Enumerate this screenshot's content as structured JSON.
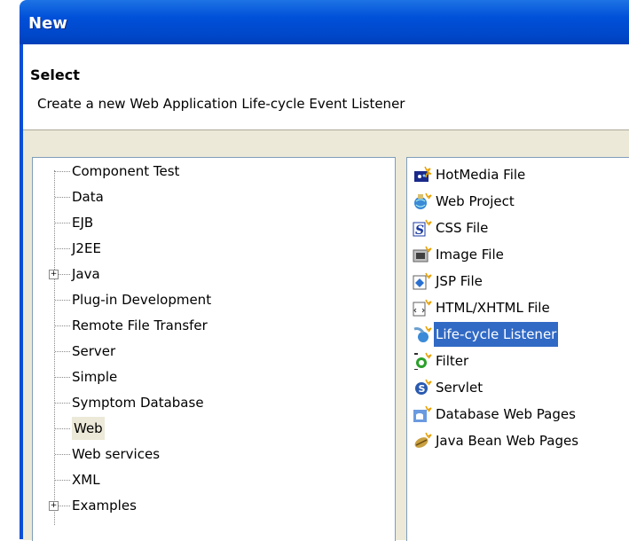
{
  "window": {
    "title": "New"
  },
  "header": {
    "title": "Select",
    "description": "Create a new Web Application Life-cycle Event Listener"
  },
  "tree": {
    "items": [
      {
        "label": "Component Test",
        "expandable": false
      },
      {
        "label": "Data",
        "expandable": false
      },
      {
        "label": "EJB",
        "expandable": false
      },
      {
        "label": "J2EE",
        "expandable": false
      },
      {
        "label": "Java",
        "expandable": true
      },
      {
        "label": "Plug-in Development",
        "expandable": false
      },
      {
        "label": "Remote File Transfer",
        "expandable": false
      },
      {
        "label": "Server",
        "expandable": false
      },
      {
        "label": "Simple",
        "expandable": false
      },
      {
        "label": "Symptom Database",
        "expandable": false
      },
      {
        "label": "Web",
        "expandable": false,
        "selected": true
      },
      {
        "label": "Web services",
        "expandable": false
      },
      {
        "label": "XML",
        "expandable": false
      },
      {
        "label": "Examples",
        "expandable": true
      }
    ],
    "expander_glyph": "+"
  },
  "wizards": {
    "items": [
      {
        "label": "HotMedia File",
        "icon": "hotmedia-file-icon"
      },
      {
        "label": "Web Project",
        "icon": "web-project-icon"
      },
      {
        "label": "CSS File",
        "icon": "css-file-icon"
      },
      {
        "label": "Image File",
        "icon": "image-file-icon"
      },
      {
        "label": "JSP File",
        "icon": "jsp-file-icon"
      },
      {
        "label": "HTML/XHTML File",
        "icon": "html-file-icon"
      },
      {
        "label": "Life-cycle Listener",
        "icon": "lifecycle-listener-icon",
        "selected": true
      },
      {
        "label": "Filter",
        "icon": "filter-icon"
      },
      {
        "label": "Servlet",
        "icon": "servlet-icon"
      },
      {
        "label": "Database Web Pages",
        "icon": "database-web-pages-icon"
      },
      {
        "label": "Java Bean Web Pages",
        "icon": "java-bean-web-pages-icon"
      }
    ]
  },
  "colors": {
    "title_bar": "#0050d8",
    "selection": "#316ac5",
    "panel_bg": "#ece9d8"
  }
}
